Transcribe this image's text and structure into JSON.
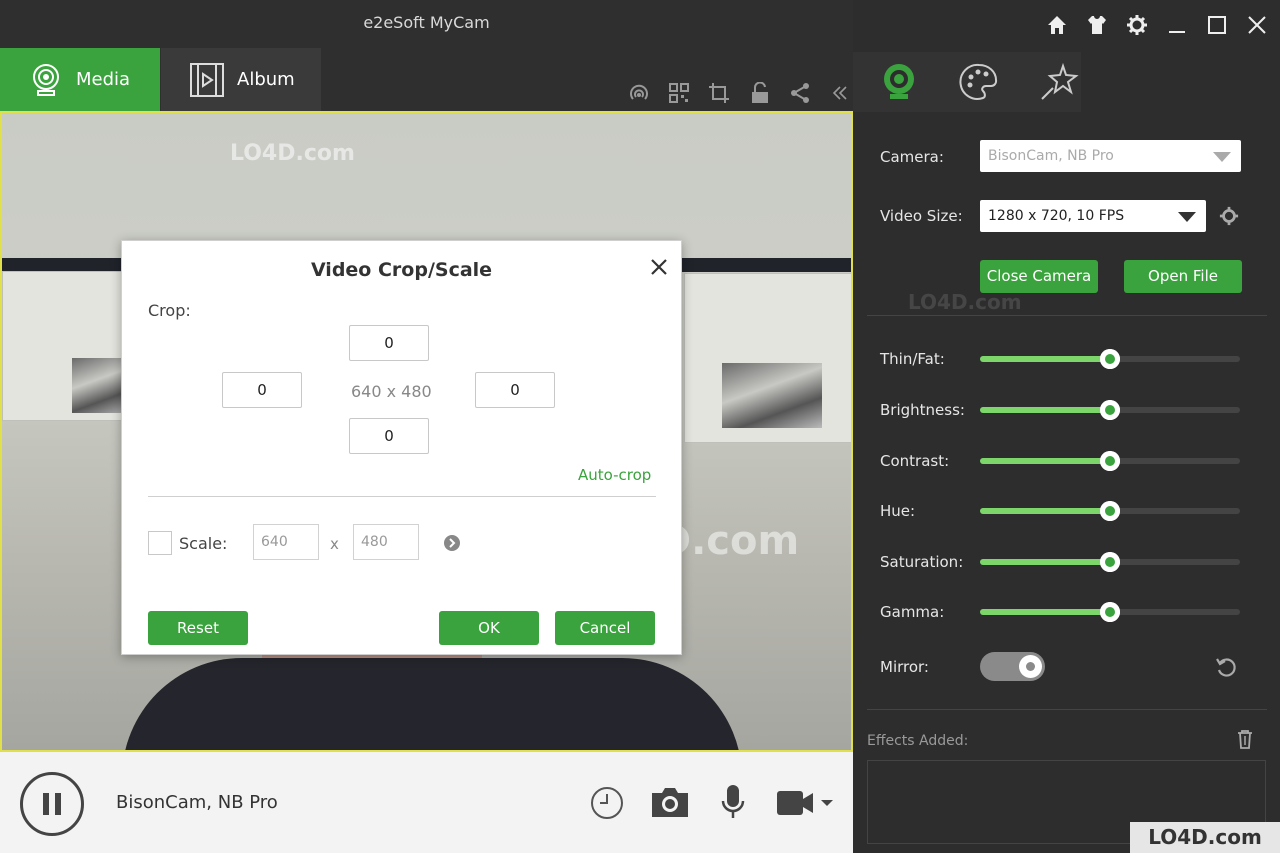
{
  "app": {
    "title": "e2eSoft MyCam"
  },
  "tabs": [
    {
      "label": "Media",
      "icon": "webcam-icon",
      "active": true
    },
    {
      "label": "Album",
      "icon": "film-icon",
      "active": false
    }
  ],
  "toolbar": {
    "icons": [
      "broadcast-icon",
      "qrcode-icon",
      "crop-icon",
      "unlock-icon",
      "share-icon",
      "collapse-icon"
    ]
  },
  "watermarks": {
    "text": "LO4D.com"
  },
  "dialog": {
    "title": "Video Crop/Scale",
    "crop_label": "Crop:",
    "crop_top": "0",
    "crop_left": "0",
    "crop_right": "0",
    "crop_bottom": "0",
    "dimensions": "640 x 480",
    "autocrop_label": "Auto-crop",
    "scale_label": "Scale:",
    "scale_width": "640",
    "scale_x": "x",
    "scale_height": "480",
    "reset_label": "Reset",
    "ok_label": "OK",
    "cancel_label": "Cancel"
  },
  "bottom": {
    "camera_name": "BisonCam, NB Pro"
  },
  "panel": {
    "camera_label": "Camera:",
    "camera_value": "BisonCam, NB Pro",
    "video_size_label": "Video Size:",
    "video_size_value": "1280 x 720, 10 FPS",
    "close_camera_label": "Close Camera",
    "open_file_label": "Open File",
    "sliders": [
      {
        "label": "Thin/Fat:",
        "value": 0.5
      },
      {
        "label": "Brightness:",
        "value": 0.5
      },
      {
        "label": "Contrast:",
        "value": 0.5
      },
      {
        "label": "Hue:",
        "value": 0.5
      },
      {
        "label": "Saturation:",
        "value": 0.5
      },
      {
        "label": "Gamma:",
        "value": 0.5
      }
    ],
    "mirror_label": "Mirror:",
    "mirror_on": true,
    "effects_label": "Effects Added:"
  },
  "colors": {
    "accent": "#3aa33d",
    "slider_fill": "#7dd66a",
    "highlight_border": "#e0e04a"
  },
  "footer_logo": "LO4D.com"
}
